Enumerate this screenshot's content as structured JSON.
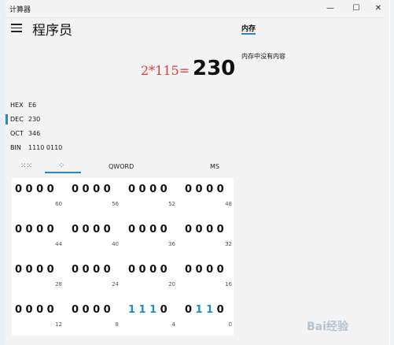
{
  "window": {
    "title": "计算器",
    "min_glyph": "—",
    "max_glyph": "☐",
    "close_glyph": "✕"
  },
  "header": {
    "mode_title": "程序员"
  },
  "display": {
    "expression": "2*115=",
    "result": "230"
  },
  "radix": [
    {
      "label": "HEX",
      "value": "E6",
      "selected": false
    },
    {
      "label": "DEC",
      "value": "230",
      "selected": true
    },
    {
      "label": "OCT",
      "value": "346",
      "selected": false
    },
    {
      "label": "BIN",
      "value": "1110 0110",
      "selected": false
    }
  ],
  "tabs": {
    "keypad_icon": "keypad-icon",
    "bits_icon": "bit-toggle-icon",
    "word_size": "QWORD",
    "memory_store": "MS"
  },
  "memory": {
    "tab_label": "内存",
    "empty_text": "内存中没有内容"
  },
  "bit_groups": [
    {
      "bits": "0000",
      "pos": "60"
    },
    {
      "bits": "0000",
      "pos": "56"
    },
    {
      "bits": "0000",
      "pos": "52"
    },
    {
      "bits": "0000",
      "pos": "48"
    },
    {
      "bits": "0000",
      "pos": "44"
    },
    {
      "bits": "0000",
      "pos": "40"
    },
    {
      "bits": "0000",
      "pos": "36"
    },
    {
      "bits": "0000",
      "pos": "32"
    },
    {
      "bits": "0000",
      "pos": "28"
    },
    {
      "bits": "0000",
      "pos": "24"
    },
    {
      "bits": "0000",
      "pos": "20"
    },
    {
      "bits": "0000",
      "pos": "16"
    },
    {
      "bits": "0000",
      "pos": "12"
    },
    {
      "bits": "0000",
      "pos": "8"
    },
    {
      "bits": "1110",
      "pos": "4"
    },
    {
      "bits": "0110",
      "pos": "0"
    }
  ],
  "colors": {
    "accent": "#2b86c5",
    "bit_on": "#1a8fc8",
    "expression": "#e03a3a"
  },
  "watermark": "Bai经验"
}
